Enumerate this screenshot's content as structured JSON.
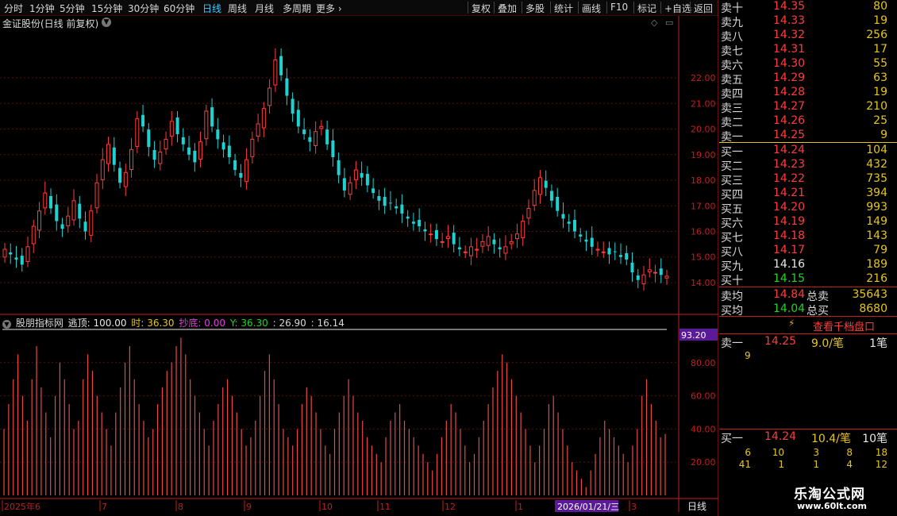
{
  "toolbar": {
    "periods": [
      "分时",
      "1分钟",
      "5分钟",
      "15分钟",
      "30分钟",
      "60分钟",
      "日线",
      "周线",
      "月线",
      "多周期",
      "更多"
    ],
    "active_period": "日线",
    "tools": [
      "复权",
      "叠加",
      "多股",
      "统计",
      "画线",
      "F10",
      "标记",
      "+自选",
      "返回"
    ]
  },
  "chart": {
    "title": "金证股份(日线 前复权)"
  },
  "indicator": {
    "name": "股朋指标网",
    "escape_label": "逃顶: 100.00",
    "time_label": "时: 36.30",
    "bottom_label": "抄底: 0.00",
    "y_label": "Y: 36.30",
    "v1": ": 26.90",
    "v2": ": 16.14",
    "current_tag": "93.20"
  },
  "bottom_axis": {
    "date_label": "2026/01/21/三",
    "period_label": "日线"
  },
  "chart_data": [
    {
      "type": "candlestick",
      "title": "金证股份(日线 前复权)",
      "y_ticks": [
        14.0,
        15.0,
        16.0,
        17.0,
        18.0,
        19.0,
        20.0,
        21.0,
        22.0
      ],
      "y_tick_labels": [
        "14.00",
        "15.00",
        "16.00",
        "17.00",
        "18.00",
        "19.00",
        "20.00",
        "21.00",
        "22.00"
      ],
      "ylim": [
        13.1,
        23.8
      ],
      "x_labels": [
        "2025年6",
        "7",
        "8",
        "9",
        "10",
        "11",
        "12",
        "1",
        "3"
      ],
      "close_series": [
        15.3,
        15.1,
        14.9,
        14.7,
        15.4,
        16.2,
        16.8,
        17.5,
        16.9,
        16.4,
        16.1,
        16.6,
        17.2,
        16.5,
        16.0,
        16.8,
        17.9,
        18.8,
        19.4,
        18.6,
        17.9,
        18.3,
        19.2,
        20.4,
        20.1,
        19.3,
        18.8,
        19.1,
        19.6,
        20.3,
        19.8,
        19.4,
        19.0,
        18.7,
        19.5,
        20.7,
        20.1,
        19.6,
        19.2,
        18.9,
        18.4,
        18.1,
        18.8,
        19.6,
        20.2,
        20.8,
        21.6,
        22.7,
        22.1,
        21.3,
        20.6,
        20.1,
        19.8,
        19.5,
        19.9,
        20.1,
        19.4,
        18.9,
        18.2,
        17.6,
        17.9,
        18.4,
        18.1,
        17.8,
        17.5,
        17.2,
        17.0,
        17.1,
        16.9,
        16.7,
        16.5,
        16.3,
        16.2,
        16.0,
        15.9,
        15.7,
        15.6,
        15.8,
        15.5,
        15.3,
        15.2,
        15.4,
        15.3,
        15.6,
        15.8,
        15.5,
        15.3,
        15.4,
        15.6,
        15.9,
        16.4,
        16.9,
        17.6,
        18.1,
        17.7,
        17.2,
        16.8,
        16.5,
        16.3,
        16.0,
        15.8,
        15.6,
        15.4,
        15.3,
        15.2,
        15.1,
        15.2,
        15.0,
        14.9,
        14.4,
        14.1,
        14.3,
        14.5,
        14.4,
        14.3,
        14.25
      ]
    },
    {
      "type": "bar",
      "title": "股朋指标网",
      "y_ticks": [
        20,
        40,
        60,
        80
      ],
      "y_tick_labels": [
        "20.00",
        "40.00",
        "60.00",
        "80.00"
      ],
      "ylim": [
        0,
        100
      ],
      "reference_line": 100,
      "values": [
        40,
        55,
        70,
        85,
        60,
        45,
        70,
        90,
        65,
        50,
        35,
        60,
        80,
        70,
        55,
        40,
        45,
        70,
        85,
        75,
        60,
        50,
        40,
        30,
        50,
        65,
        80,
        90,
        70,
        55,
        45,
        35,
        40,
        55,
        65,
        75,
        80,
        90,
        95,
        85,
        70,
        60,
        50,
        40,
        30,
        45,
        55,
        65,
        70,
        60,
        50,
        40,
        30,
        35,
        45,
        60,
        75,
        85,
        70,
        55,
        40,
        35,
        30,
        40,
        55,
        65,
        60,
        50,
        40,
        30,
        25,
        40,
        50,
        60,
        70,
        60,
        50,
        45,
        35,
        30,
        25,
        20,
        35,
        45,
        50,
        55,
        45,
        40,
        35,
        30,
        25,
        20,
        15,
        25,
        35,
        45,
        55,
        50,
        40,
        30,
        20,
        25,
        35,
        45,
        55,
        65,
        75,
        85,
        80,
        70,
        60,
        50,
        40,
        30,
        20,
        30,
        40,
        55,
        60,
        50,
        40,
        30,
        20,
        15,
        10,
        5,
        15,
        25,
        35,
        45,
        40,
        35,
        30,
        25,
        20,
        30,
        40,
        60,
        70,
        55,
        45,
        35,
        37
      ]
    }
  ],
  "quote": {
    "sell": [
      {
        "label": "卖十",
        "price": "14.35",
        "vol": "80"
      },
      {
        "label": "卖九",
        "price": "14.33",
        "vol": "19"
      },
      {
        "label": "卖八",
        "price": "14.32",
        "vol": "256"
      },
      {
        "label": "卖七",
        "price": "14.31",
        "vol": "17"
      },
      {
        "label": "卖六",
        "price": "14.30",
        "vol": "55"
      },
      {
        "label": "卖五",
        "price": "14.29",
        "vol": "63"
      },
      {
        "label": "卖四",
        "price": "14.28",
        "vol": "19"
      },
      {
        "label": "卖三",
        "price": "14.27",
        "vol": "210"
      },
      {
        "label": "卖二",
        "price": "14.26",
        "vol": "25"
      },
      {
        "label": "卖一",
        "price": "14.25",
        "vol": "9"
      }
    ],
    "buy": [
      {
        "label": "买一",
        "price": "14.24",
        "vol": "104"
      },
      {
        "label": "买二",
        "price": "14.23",
        "vol": "432"
      },
      {
        "label": "买三",
        "price": "14.22",
        "vol": "735"
      },
      {
        "label": "买四",
        "price": "14.21",
        "vol": "394"
      },
      {
        "label": "买五",
        "price": "14.20",
        "vol": "993"
      },
      {
        "label": "买六",
        "price": "14.19",
        "vol": "149"
      },
      {
        "label": "买七",
        "price": "14.18",
        "vol": "143"
      },
      {
        "label": "买八",
        "price": "14.17",
        "vol": "79"
      },
      {
        "label": "买九",
        "price": "14.16",
        "vol": "189"
      },
      {
        "label": "买十",
        "price": "14.15",
        "vol": "216"
      }
    ],
    "avg_sell_label": "卖均",
    "avg_sell": "14.84",
    "total_sell_label": "总卖",
    "total_sell": "35643",
    "avg_buy_label": "买均",
    "avg_buy": "14.04",
    "total_buy_label": "总买",
    "total_buy": "8680",
    "depth_button": "查看千档盘口",
    "ask1": {
      "label": "卖一",
      "price": "14.25",
      "per": "9.0/笔",
      "count": "1笔",
      "orders": [
        "9"
      ]
    },
    "bid1": {
      "label": "买一",
      "price": "14.24",
      "per": "10.4/笔",
      "count": "10笔",
      "orders_row1": [
        "6",
        "10",
        "3",
        "8",
        "18"
      ],
      "orders_row2": [
        "41",
        "1",
        "1",
        "4",
        "12"
      ]
    }
  },
  "logo": {
    "title": "乐淘公式网",
    "url": "www.60lt.com"
  },
  "colors": {
    "up": "#ff3c3c",
    "down": "#1ed2d2",
    "grid": "#5a0f0f",
    "axis": "#c41e1e",
    "accent": "#e6c619"
  }
}
